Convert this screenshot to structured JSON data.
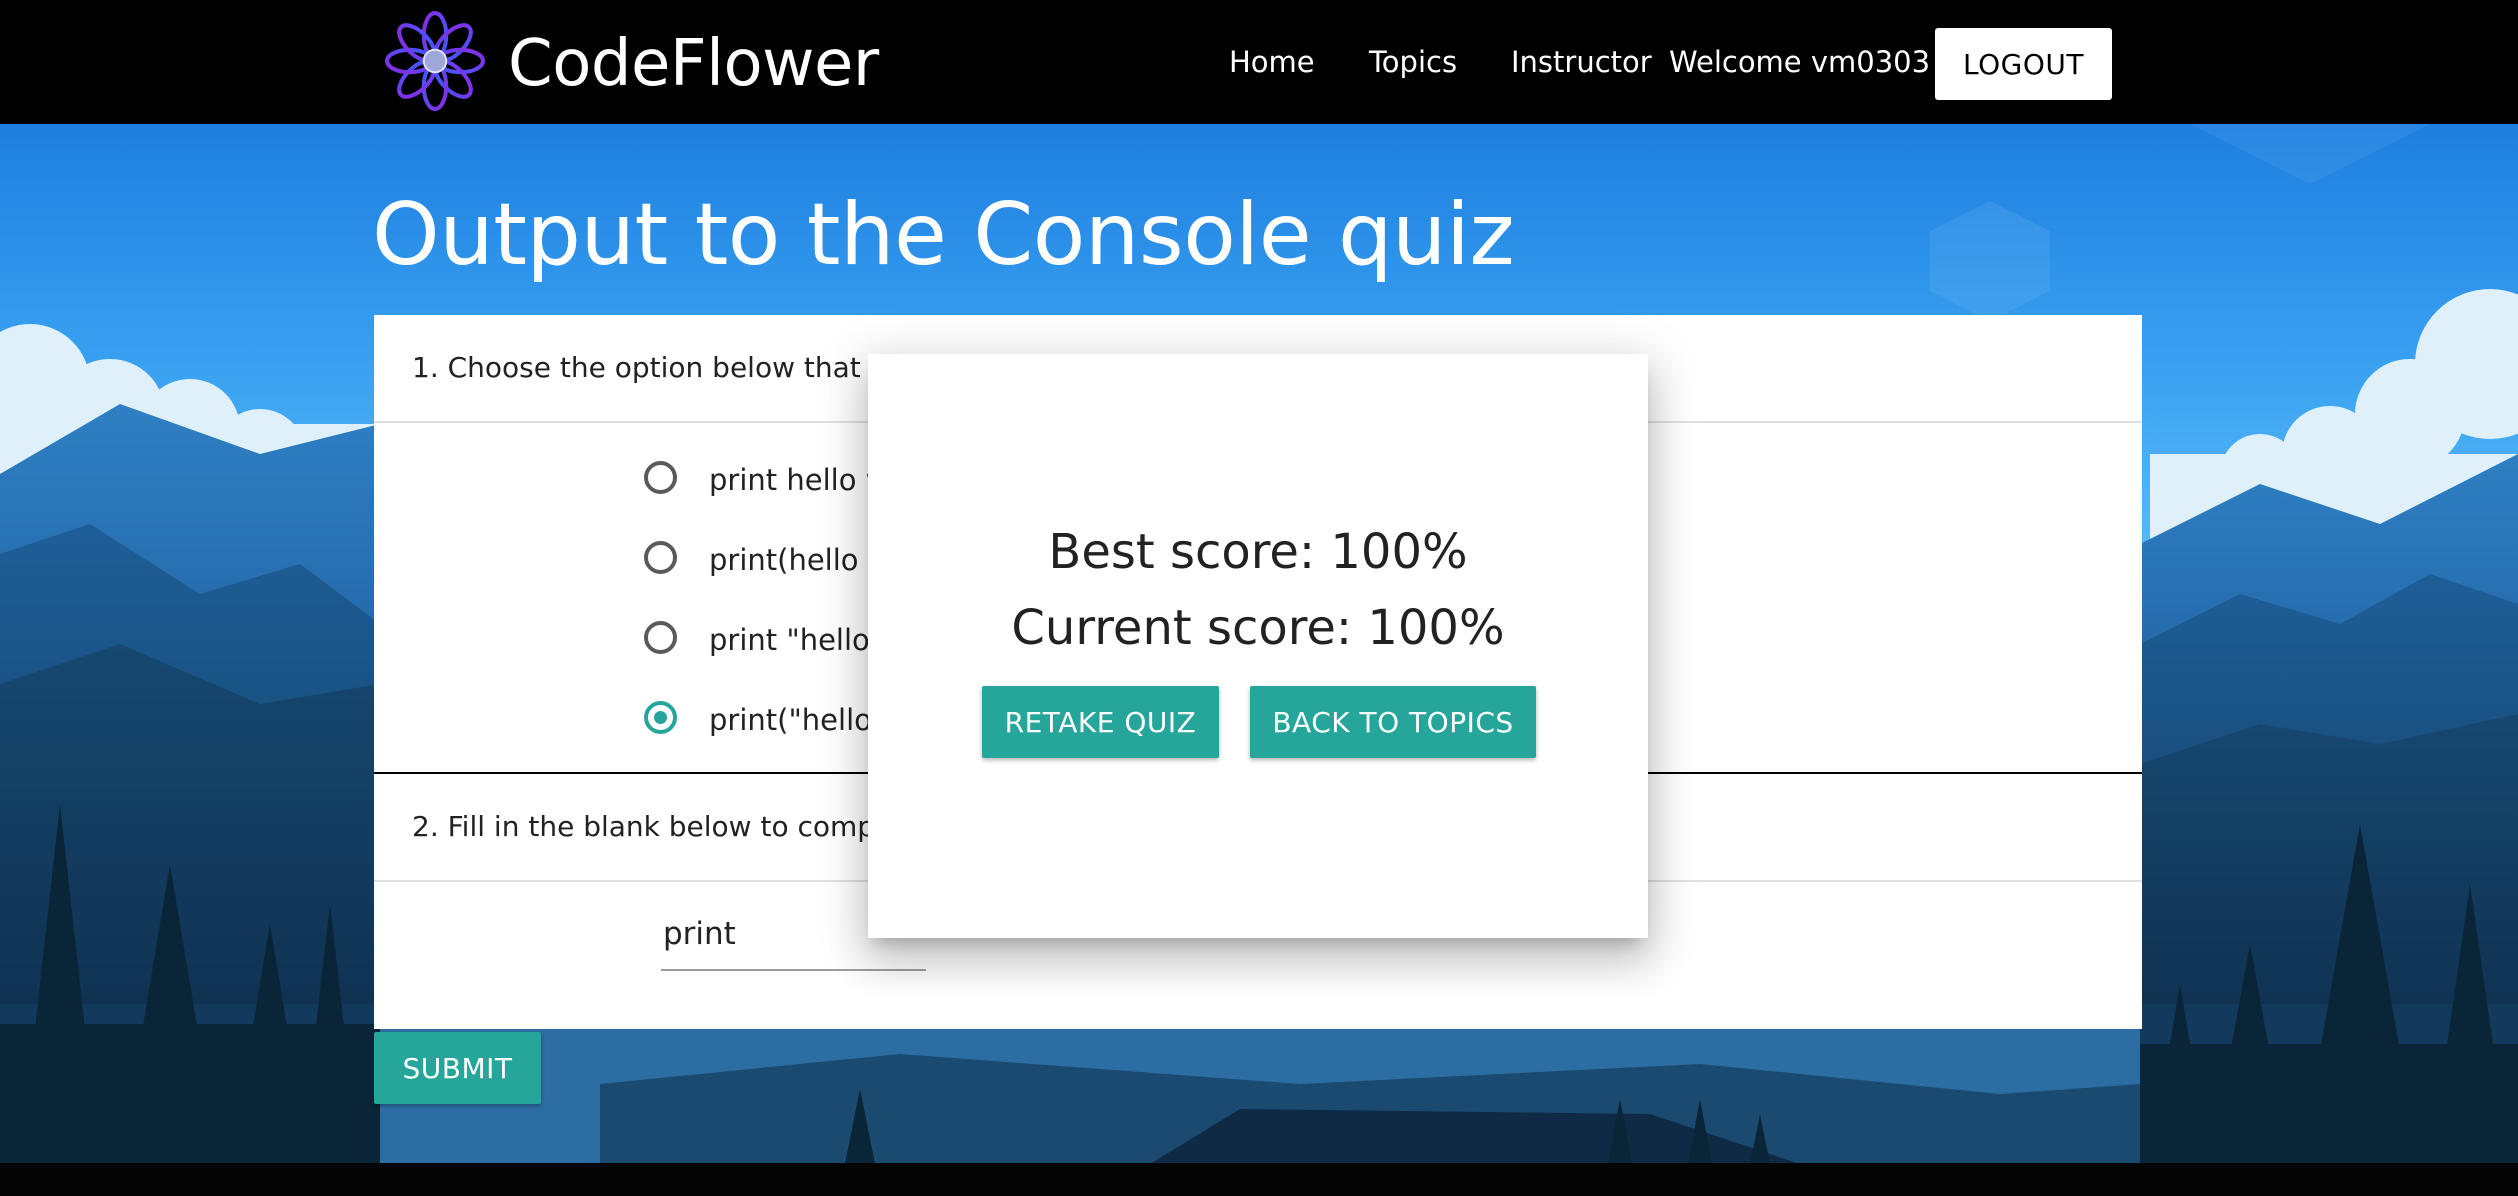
{
  "navbar": {
    "brand": "CodeFlower",
    "logo_icon": "flower-logo-icon",
    "links": [
      "Home",
      "Topics",
      "Instructor"
    ],
    "welcome": "Welcome vm0303",
    "logout_label": "LOGOUT"
  },
  "page": {
    "title": "Output to the Console quiz"
  },
  "quiz": {
    "q1": {
      "text": "1. Choose the option below that co",
      "options": [
        "print hello w",
        "print(hello w",
        "print \"hello w",
        "print(\"hello w"
      ],
      "selected_index": 3
    },
    "q2": {
      "text": "2. Fill in the blank below to comple",
      "input_value": "print"
    },
    "submit_label": "SUBMIT"
  },
  "modal": {
    "best_score": "Best score: 100%",
    "current_score": "Current score: 100%",
    "retake_label": "RETAKE QUIZ",
    "back_label": "BACK TO TOPICS"
  },
  "colors": {
    "accent": "#26a69a",
    "navbar": "#000000",
    "sky_top": "#1976d2"
  }
}
